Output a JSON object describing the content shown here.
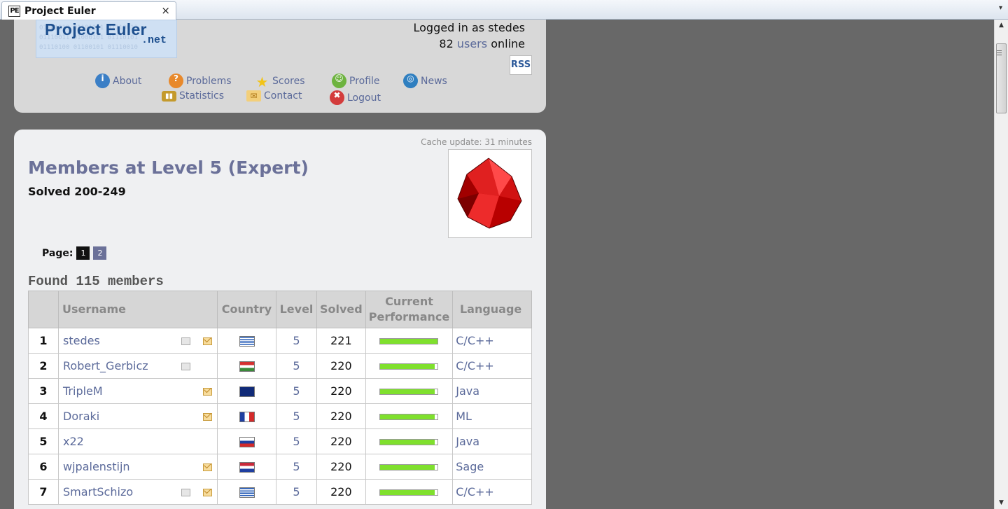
{
  "browser": {
    "tab_title": "Project Euler",
    "tab_icon_text": "PE",
    "close_glyph": "×",
    "menu_glyph": "▾"
  },
  "header": {
    "logo_main": "Project Euler",
    "logo_net": ".net",
    "logged_in_text": "Logged in as stedes",
    "users_online_count": "82",
    "users_link": "users",
    "online_word": "online",
    "rss_label": "RSS",
    "nav": [
      {
        "label": "About",
        "icon": "about-icon",
        "color": "#3b7fc6"
      },
      {
        "label": "Problems",
        "icon": "problems-icon",
        "color": "#e8892b"
      },
      {
        "label": "Scores",
        "icon": "star-icon",
        "color": "#f2c418"
      },
      {
        "label": "Profile",
        "icon": "profile-icon",
        "color": "#6db33f"
      },
      {
        "label": "News",
        "icon": "news-icon",
        "color": "#2f7fc0"
      },
      {
        "label": "Statistics",
        "icon": "statistics-icon",
        "color": "#c49a2c"
      },
      {
        "label": "Contact",
        "icon": "contact-icon",
        "color": "#e0a23a"
      },
      {
        "label": "Logout",
        "icon": "logout-icon",
        "color": "#d33c3c"
      }
    ]
  },
  "main": {
    "cache_update": "Cache update: 31 minutes",
    "title": "Members at Level 5 (Expert)",
    "subtitle": "Solved 200-249",
    "page_label": "Page:",
    "pages": [
      "1",
      "2"
    ],
    "current_page": "1",
    "found_text": "Found 115 members",
    "columns": [
      "",
      "Username",
      "Country",
      "Level",
      "Solved",
      "Current Performance",
      "Language"
    ],
    "rows": [
      {
        "rank": "1",
        "username": "stedes",
        "doc": true,
        "mail": true,
        "flag": "greece",
        "level": "5",
        "solved": "221",
        "performance": 1.0,
        "language": "C/C++"
      },
      {
        "rank": "2",
        "username": "Robert_Gerbicz",
        "doc": true,
        "mail": false,
        "flag": "hungary",
        "level": "5",
        "solved": "220",
        "performance": 0.95,
        "language": "C/C++"
      },
      {
        "rank": "3",
        "username": "TripleM",
        "doc": false,
        "mail": true,
        "flag": "new-zealand",
        "level": "5",
        "solved": "220",
        "performance": 0.95,
        "language": "Java"
      },
      {
        "rank": "4",
        "username": "Doraki",
        "doc": false,
        "mail": true,
        "flag": "france",
        "level": "5",
        "solved": "220",
        "performance": 0.95,
        "language": "ML"
      },
      {
        "rank": "5",
        "username": "x22",
        "doc": false,
        "mail": false,
        "flag": "slovakia",
        "level": "5",
        "solved": "220",
        "performance": 0.95,
        "language": "Java"
      },
      {
        "rank": "6",
        "username": "wjpalenstijn",
        "doc": false,
        "mail": true,
        "flag": "netherlands",
        "level": "5",
        "solved": "220",
        "performance": 0.95,
        "language": "Sage"
      },
      {
        "rank": "7",
        "username": "SmartSchizo",
        "doc": true,
        "mail": true,
        "flag": "greece",
        "level": "5",
        "solved": "220",
        "performance": 0.95,
        "language": "C/C++"
      }
    ]
  }
}
